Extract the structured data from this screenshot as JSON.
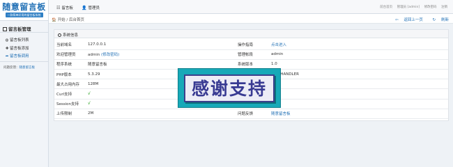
{
  "sidebar": {
    "logo_title": "随意留言板",
    "logo_subtitle": "一款简单好用的留言板系统",
    "section_title": "留言板管理",
    "items": [
      {
        "label": "留言板列表",
        "icon": "globe-icon"
      },
      {
        "label": "留言板添加",
        "icon": "plus-icon"
      },
      {
        "label": "留言板调用",
        "icon": "share-icon"
      }
    ],
    "footer_prefix": "问题反馈：",
    "footer_link": "随意留言板"
  },
  "topbar": {
    "tabs": [
      {
        "label": "留言板",
        "icon": "list-icon"
      },
      {
        "label": "管理员",
        "icon": "user-icon"
      }
    ],
    "links": [
      "前台首页",
      "管理员 [admin]",
      "修改密码",
      "注销"
    ]
  },
  "breadcrumb": {
    "home": "开始",
    "separator": "/",
    "current": "后台首页",
    "back": "返回上一页",
    "refresh": "刷新"
  },
  "panel": {
    "title": "系统信息",
    "rows": [
      {
        "k1": "当前域名",
        "v1": "127.0.0.1",
        "k2": "操作指南",
        "v2": "点击进入",
        "v2_link": true
      },
      {
        "k1": "欢迎管理员",
        "v1": "admin",
        "v1_extra": "(修改密码)",
        "k2": "管理帐段",
        "v2": "admin"
      },
      {
        "k1": "程序系统",
        "v1": "随意留言板",
        "k2": "系统版本",
        "v2": "1.0"
      },
      {
        "k1": "PHP版本",
        "v1": "5.3.29",
        "k2": "",
        "v2": "CHE/HANDLER"
      },
      {
        "k1": "最大占用内存",
        "v1": "128M",
        "k2": "",
        "v2": ""
      },
      {
        "k1": "Curl支持",
        "v1": "√",
        "k2": "",
        "v2": ""
      },
      {
        "k1": "Session支持",
        "v1": "√",
        "k2": "",
        "v2": ""
      },
      {
        "k1": "上传限制",
        "v1": "2M",
        "k2": "问题反馈",
        "v2": "随意留言板",
        "v2_link": true
      }
    ]
  },
  "banner": {
    "text": "感谢支持"
  },
  "colors": {
    "accent": "#1f6fb5",
    "banner_bg": "#17a9b8",
    "banner_text": "#383a92",
    "check": "#3aa832"
  }
}
